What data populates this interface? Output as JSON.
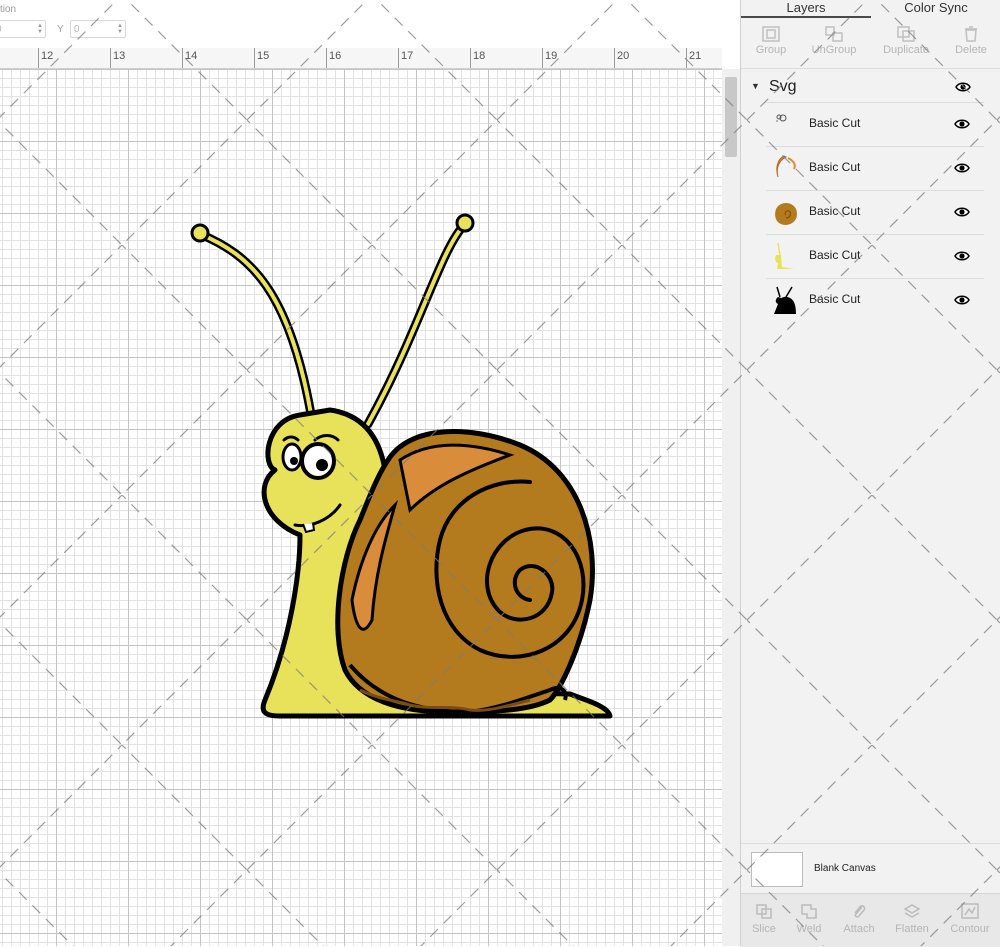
{
  "topbar": {
    "label_x_partial": "tion",
    "x_value": "0",
    "y_label": "Y",
    "y_value": "0"
  },
  "ruler": {
    "ticks": [
      "12",
      "13",
      "14",
      "15",
      "16",
      "17",
      "18",
      "19",
      "20",
      "21"
    ]
  },
  "panel": {
    "tabs": {
      "layers": "Layers",
      "color_sync": "Color Sync"
    },
    "toolbar": {
      "group": "Group",
      "ungroup": "UnGroup",
      "duplicate": "Duplicate",
      "delete": "Delete"
    },
    "group_name": "Svg",
    "layers": [
      {
        "name": "Basic Cut",
        "thumb": "facial-details-thumbnail"
      },
      {
        "name": "Basic Cut",
        "thumb": "shell-highlight-thumbnail"
      },
      {
        "name": "Basic Cut",
        "thumb": "brown-shell-thumbnail"
      },
      {
        "name": "Basic Cut",
        "thumb": "yellow-body-thumbnail"
      },
      {
        "name": "Basic Cut",
        "thumb": "black-outline-thumbnail"
      }
    ],
    "blank_canvas": "Blank Canvas",
    "bottom_toolbar": {
      "slice": "Slice",
      "weld": "Weld",
      "attach": "Attach",
      "flatten": "Flatten",
      "contour": "Contour"
    }
  },
  "colors": {
    "snail_body": "#e8e25a",
    "shell": "#b47a1e",
    "shell_highlight": "#d98c3a",
    "outline": "#000000"
  }
}
